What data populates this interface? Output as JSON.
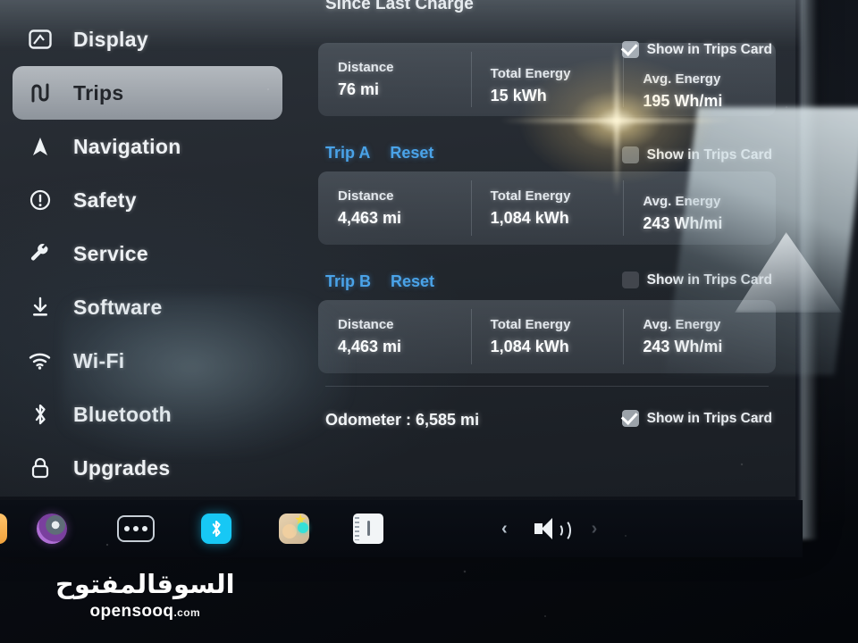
{
  "sidebar": {
    "items": [
      {
        "label": "Display",
        "icon": "display-icon",
        "active": false
      },
      {
        "label": "Trips",
        "icon": "trips-icon",
        "active": true
      },
      {
        "label": "Navigation",
        "icon": "navigation-icon",
        "active": false
      },
      {
        "label": "Safety",
        "icon": "safety-icon",
        "active": false
      },
      {
        "label": "Service",
        "icon": "wrench-icon",
        "active": false
      },
      {
        "label": "Software",
        "icon": "download-icon",
        "active": false
      },
      {
        "label": "Wi-Fi",
        "icon": "wifi-icon",
        "active": false
      },
      {
        "label": "Bluetooth",
        "icon": "bluetooth-icon",
        "active": false
      },
      {
        "label": "Upgrades",
        "icon": "lock-icon",
        "active": false
      }
    ]
  },
  "content": {
    "since_last_charge": {
      "title": "Since Last Charge",
      "show_in_trips_card_label": "Show in Trips Card",
      "show_in_trips_card_checked": true,
      "stats": [
        {
          "key": "Distance",
          "value": "76 mi"
        },
        {
          "key": "Total Energy",
          "value": "15 kWh"
        },
        {
          "key": "Avg. Energy",
          "value": "195 Wh/mi"
        }
      ]
    },
    "trip_a": {
      "name": "Trip A",
      "reset_label": "Reset",
      "show_in_trips_card_label": "Show in Trips Card",
      "show_in_trips_card_checked": false,
      "stats": [
        {
          "key": "Distance",
          "value": "4,463 mi"
        },
        {
          "key": "Total Energy",
          "value": "1,084 kWh"
        },
        {
          "key": "Avg. Energy",
          "value": "243 Wh/mi"
        }
      ]
    },
    "trip_b": {
      "name": "Trip B",
      "reset_label": "Reset",
      "show_in_trips_card_label": "Show in Trips Card",
      "show_in_trips_card_checked": false,
      "stats": [
        {
          "key": "Distance",
          "value": "4,463 mi"
        },
        {
          "key": "Total Energy",
          "value": "1,084 kWh"
        },
        {
          "key": "Avg. Energy",
          "value": "243 Wh/mi"
        }
      ]
    },
    "odometer": {
      "text": "Odometer :  6,585 mi",
      "show_in_trips_card_label": "Show in Trips Card",
      "show_in_trips_card_checked": true
    }
  },
  "taskbar": {
    "icons": [
      {
        "name": "media-icon"
      },
      {
        "name": "camera-icon"
      },
      {
        "name": "more-dots-icon"
      },
      {
        "name": "bluetooth-icon"
      },
      {
        "name": "apps-icon"
      },
      {
        "name": "card-icon"
      }
    ],
    "volume": {
      "prev_label": "‹",
      "next_label": "›",
      "speaker_icon": "speaker-icon"
    }
  },
  "watermark": {
    "arabic": "السوقالمفتوح",
    "latin": "opensooq",
    "tld": ".com"
  },
  "colors": {
    "accent_blue": "#4aa3e8",
    "screen_bg": "#262b32",
    "card_bg": "#6e7984",
    "text": "#f2f4f6"
  }
}
